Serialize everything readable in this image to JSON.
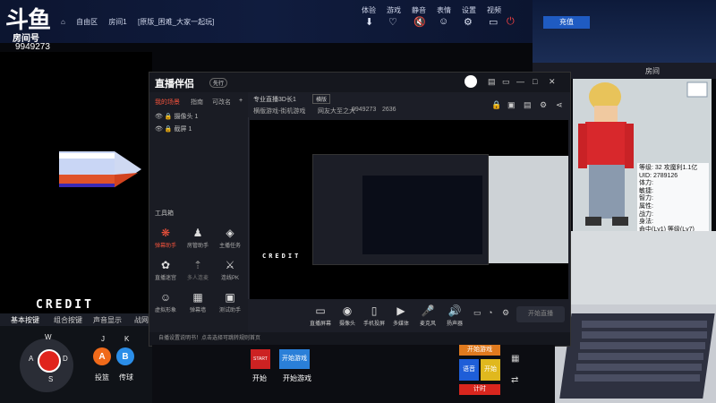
{
  "topbar": {
    "logo": "斗鱼",
    "room_label": "房间号",
    "room_no": "9949273",
    "crumbs": [
      "自由区",
      "房间1",
      "[原版_困难_大家一起玩]"
    ],
    "menu": [
      "体验",
      "游戏",
      "静音",
      "表情",
      "设置",
      "视频"
    ]
  },
  "game": {
    "credit": "CREDIT"
  },
  "controls": {
    "tabs": [
      "基本按键",
      "组合按键",
      "声音显示",
      "战网"
    ],
    "keys": {
      "w": "W",
      "a": "A",
      "s": "S",
      "d": "D",
      "j": "J",
      "k": "K"
    },
    "btn_a": "A",
    "btn_b": "B",
    "label_a": "投篮",
    "label_b": "传球"
  },
  "window": {
    "brand": "直播伴侣",
    "badge": "先行",
    "side_tabs": [
      "我的场景",
      "指南",
      "可改名"
    ],
    "sources": [
      "摄像头 1",
      "截屏 1"
    ],
    "toolbox": "工具箱",
    "tools": [
      "弹幕助手",
      "房管助手",
      "主播任务",
      "直播迷宫",
      "多人连麦",
      "连线PK",
      "虚拟形象",
      "弹幕墙",
      "测试助手"
    ],
    "header": {
      "mode": "专业直播3D长1",
      "tag": "横版",
      "title": "横版游戏-街机游戏",
      "status": "网友大至之大",
      "num": "9949273",
      "heat": "2636"
    },
    "bottom_tools": [
      "直播屏幕",
      "摄像头",
      "手机投屏",
      "多媒体",
      "麦克风",
      "扬声器"
    ],
    "go_live": "开始直播",
    "notice": "自播设置说明书！点击选择可跳转规则首页"
  },
  "bottom": {
    "start_label": "START",
    "start": "开始",
    "start_game_btn": "开始游戏",
    "start_game": "开始游戏",
    "right_btns": [
      "开始游戏",
      "语音",
      "开始",
      "计时"
    ]
  },
  "right": {
    "top_label": "充值",
    "room_label": "房间",
    "stats": [
      "等级: 32  攻魔利1.1亿",
      "UID: 2789126",
      "体力:",
      "敏捷:",
      "智力:",
      "属性:",
      "战力:",
      "身法:",
      "防御:",
      "暴击:",
      "命中(Lv1)  等级(Lv7)"
    ]
  }
}
